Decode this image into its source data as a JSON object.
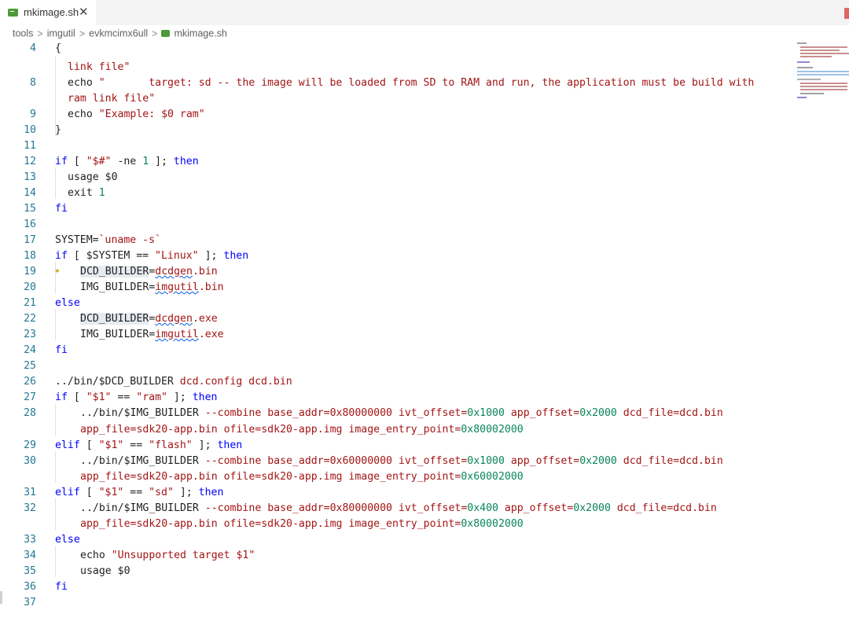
{
  "tab": {
    "label": "mkimage.sh",
    "close": "✕",
    "icon": "terminal-file-icon"
  },
  "breadcrumb": {
    "items": [
      "tools",
      "imgutil",
      "evkmcimx6ull",
      "mkimage.sh"
    ],
    "sep": ">"
  },
  "colors": {
    "keyword": "#0000ff",
    "string": "#a31515",
    "number": "#098658",
    "line_number": "#237893"
  },
  "lines": {
    "l4_n": "4",
    "l4_c": "{",
    "w1_c": "link file\"",
    "l8_n": "8",
    "l8_a": "echo ",
    "l8_s": "\"       target: sd -- the image will be loaded from SD to RAM and run, the application must be build with",
    "w2_c": "ram link file\"",
    "l9_n": "9",
    "l9_a": "echo ",
    "l9_s": "\"Example: $0 ram\"",
    "l10_n": "10",
    "l10_c": "}",
    "l11_n": "11",
    "l12_n": "12",
    "l12_a": "if",
    "l12_b": " [ ",
    "l12_s": "\"$#\"",
    "l12_c": " -ne ",
    "l12_num": "1",
    "l12_d": " ]; ",
    "l12_e": "then",
    "l13_n": "13",
    "l13_c": "usage $0",
    "l14_n": "14",
    "l14_a": "exit ",
    "l14_num": "1",
    "l15_n": "15",
    "l15_c": "fi",
    "l16_n": "16",
    "l17_n": "17",
    "l17_a": "SYSTEM=",
    "l17_s": "`uname -s`",
    "l18_n": "18",
    "l18_a": "if",
    "l18_b": " [ $SYSTEM == ",
    "l18_s": "\"Linux\"",
    "l18_d": " ]; ",
    "l18_e": "then",
    "l19_n": "19",
    "l19_a": "DCD_BUILDER",
    "l19_b": "=",
    "l19_s": "dcdgen",
    "l19_t": ".bin",
    "l20_n": "20",
    "l20_a": "IMG_BUILDER=",
    "l20_s": "imgutil",
    "l20_t": ".bin",
    "l21_n": "21",
    "l21_c": "else",
    "l22_n": "22",
    "l22_a": "DCD_BUILDER",
    "l22_b": "=",
    "l22_s": "dcdgen",
    "l22_t": ".exe",
    "l23_n": "23",
    "l23_a": "IMG_BUILDER=",
    "l23_s": "imgutil",
    "l23_t": ".exe",
    "l24_n": "24",
    "l24_c": "fi",
    "l25_n": "25",
    "l26_n": "26",
    "l26_a": "../bin/$DCD_BUILDER",
    "l26_s": " dcd.config dcd.bin",
    "l27_n": "27",
    "l27_a": "if",
    "l27_b": " [ ",
    "l27_s1": "\"$1\"",
    "l27_c": " == ",
    "l27_s2": "\"ram\"",
    "l27_d": " ]; ",
    "l27_e": "then",
    "l28_n": "28",
    "l28_a": "../bin/$IMG_BUILDER",
    "l28_s1": " --combine base_addr=0x80000000 ivt_offset=",
    "l28_n1": "0x1000",
    "l28_s2": " app_offset=",
    "l28_n2": "0x2000",
    "l28_s3": " dcd_file=dcd.bin",
    "w28_s": "app_file=sdk20-app.bin ofile=sdk20-app.img image_entry_point=",
    "w28_num": "0x80002000",
    "l29_n": "29",
    "l29_a": "elif",
    "l29_b": " [ ",
    "l29_s1": "\"$1\"",
    "l29_c": " == ",
    "l29_s2": "\"flash\"",
    "l29_d": " ]; ",
    "l29_e": "then",
    "l30_n": "30",
    "l30_a": "../bin/$IMG_BUILDER",
    "l30_s1": " --combine base_addr=0x60000000 ivt_offset=",
    "l30_n1": "0x1000",
    "l30_s2": " app_offset=",
    "l30_n2": "0x2000",
    "l30_s3": " dcd_file=dcd.bin",
    "w30_s": "app_file=sdk20-app.bin ofile=sdk20-app.img image_entry_point=",
    "w30_num": "0x60002000",
    "l31_n": "31",
    "l31_a": "elif",
    "l31_b": " [ ",
    "l31_s1": "\"$1\"",
    "l31_c": " == ",
    "l31_s2": "\"sd\"",
    "l31_d": " ]; ",
    "l31_e": "then",
    "l32_n": "32",
    "l32_a": "../bin/$IMG_BUILDER",
    "l32_s1": " --combine base_addr=0x80000000 ivt_offset=",
    "l32_n1": "0x400",
    "l32_s2": " app_offset=",
    "l32_n2": "0x2000",
    "l32_s3": " dcd_file=dcd.bin",
    "w32_s": "app_file=sdk20-app.bin ofile=sdk20-app.img image_entry_point=",
    "w32_num": "0x80002000",
    "l33_n": "33",
    "l33_c": "else",
    "l34_n": "34",
    "l34_a": "echo ",
    "l34_s": "\"Unsupported target $1\"",
    "l35_n": "35",
    "l35_c": "usage $0",
    "l36_n": "36",
    "l36_c": "fi",
    "l37_n": "37"
  }
}
